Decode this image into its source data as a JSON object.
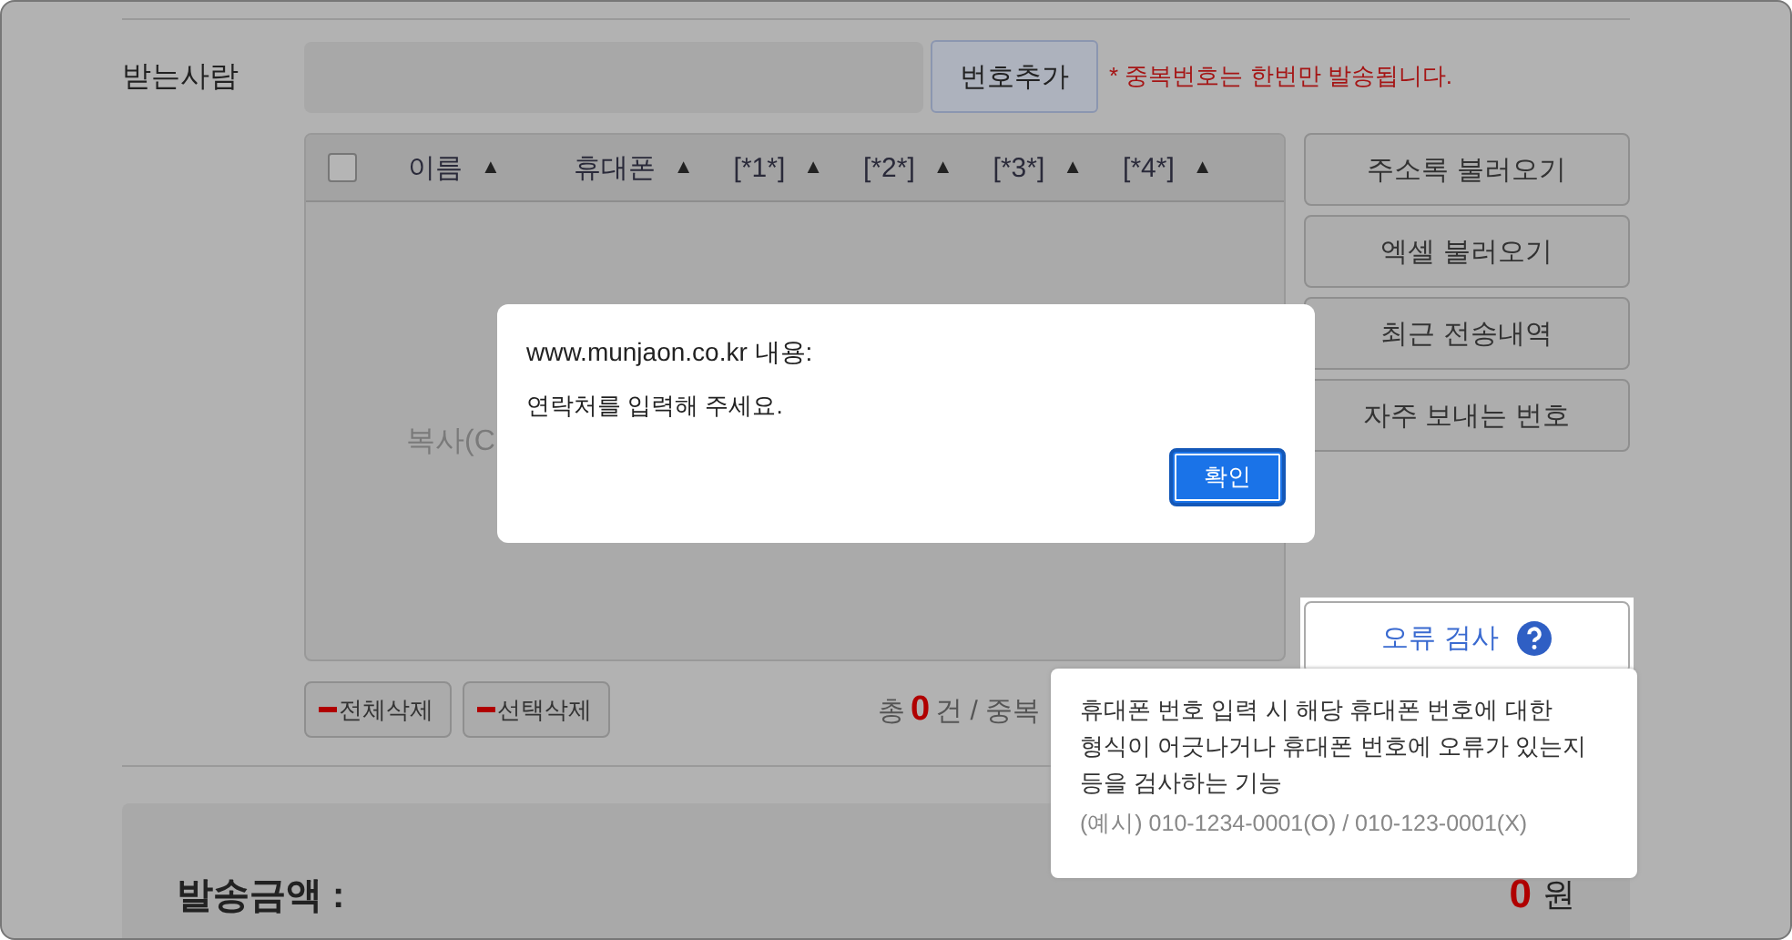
{
  "recipient": {
    "label": "받는사람",
    "add_button": "번호추가",
    "note": "* 중복번호는 한번만 발송됩니다."
  },
  "table": {
    "select_all_checked": false,
    "columns": [
      {
        "label": "이름",
        "sort_icon": "▲"
      },
      {
        "label": "휴대폰",
        "sort_icon": "▲"
      },
      {
        "label": "[*1*]",
        "sort_icon": "▲"
      },
      {
        "label": "[*2*]",
        "sort_icon": "▲"
      },
      {
        "label": "[*3*]",
        "sort_icon": "▲"
      },
      {
        "label": "[*4*]",
        "sort_icon": "▲"
      }
    ],
    "body_text": "복사(C"
  },
  "side_buttons": [
    "주소록 불러오기",
    "엑셀 불러오기",
    "최근 전송내역",
    "자주 보내는 번호"
  ],
  "check_button": {
    "label": "오류 검사"
  },
  "delete_buttons": [
    "전체삭제",
    "선택삭제"
  ],
  "counts": {
    "prefix": "총",
    "total": "0",
    "suffix": "건 / 중복"
  },
  "amount": {
    "label": "발송금액 :",
    "value": "0",
    "unit": "원"
  },
  "dialog": {
    "title": "www.munjaon.co.kr 내용:",
    "message": "연락처를 입력해 주세요.",
    "ok_button": "확인"
  },
  "tooltip": {
    "lines": [
      "휴대폰 번호 입력 시 해당 휴대폰 번호에 대한",
      "형식이 어긋나거나 휴대폰 번호에 오류가 있는지",
      "등을 검사하는 기능"
    ],
    "example": "(예시) 010-1234-0001(O) / 010-123-0001(X)"
  }
}
